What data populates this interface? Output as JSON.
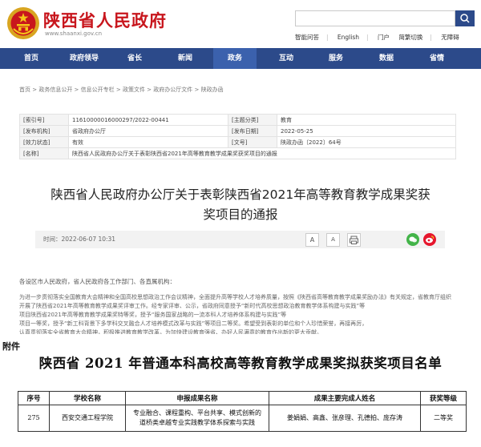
{
  "header": {
    "site_title": "陕西省人民政府",
    "site_url": "www.shaanxi.gov.cn",
    "top_links": [
      "智能问答",
      "English",
      "门户",
      "简繁切换",
      "无障碍"
    ]
  },
  "nav": {
    "items": [
      "首页",
      "政府领导",
      "省长",
      "新闻",
      "政务",
      "互动",
      "服务",
      "数据",
      "省情"
    ],
    "active": "政务"
  },
  "breadcrumb": "首页 > 政务信息公开 > 信息公开专栏 > 政策文件 > 政府办公厅文件 > 陕政办函",
  "info": {
    "labels": [
      "[索引号]",
      "[主题分类]",
      "[发布机构]",
      "[发布日期]",
      "[效力状态]",
      "[文号]",
      "[名称]"
    ],
    "index_no": "11610000016000297/2022-00441",
    "topic": "教育",
    "publisher": "省政府办公厅",
    "publish_date": "2022-05-25",
    "status": "有效",
    "doc_no": "陕政办函〔2022〕64号",
    "name": "陕西省人民政府办公厅关于表彰陕西省2021年高等教育教学成果奖获奖项目的通报"
  },
  "doc": {
    "title_line1": "陕西省人民政府办公厅关于表彰陕西省2021年高等教育教学成果奖获",
    "title_line2": "奖项目的通报"
  },
  "toolbar": {
    "date": "时间：2022-06-07 10:31",
    "font_large": "A",
    "font_small": "A",
    "print_icon": "print-icon",
    "share_icons": [
      "wechat-icon",
      "weibo-icon"
    ]
  },
  "body": {
    "greeting": "各设区市人民政府，省人民政府各工作部门、各直属机构：",
    "lines": [
      "为进一步贯彻落实全国教育大会精神和全国高校思想政治工作会议精神，全面提升高等学校人才培养质量，按照《陕西省高等教育教学成果奖励办法》有关规定，省教育厅组织",
      "开展了陕西省2021年高等教育教学成果奖评审工作。经专家评审、公示，省政府同意授予“新时代高校思想政治教育教学体系构建与实践”等",
      "项目陕西省2021年高等教育教学成果奖特等奖，授予“服务国家战略的一流本科人才培养体系构建与实践”等",
      "项目一等奖，授予“新工科背景下多学科交叉融合人才培养模式改革与实践”等项目二等奖。希望受到表彰的单位和个人珍惜荣誉，再接再厉，",
      "认真贯彻落实全省教育大会精神，积极推进教育教学改革，为加快建设教育强省、办好人民满意的教育作出新的更大贡献。"
    ]
  },
  "attachment": {
    "label": "附件",
    "title": "陕西省 2021 年普通本科高校高等教育教学成果奖拟获奖项目名单",
    "columns": [
      "序号",
      "学校名称",
      "申报成果名称",
      "成果主要完成人姓名",
      "获奖等级"
    ],
    "rows": [
      {
        "no": "275",
        "school": "西安交通工程学院",
        "title_line1": "专业融合、课程重构、平台共享、模式创新的",
        "title_line2": "道桥类卓越专业实践教学体系探索与实践",
        "people": "姜娟娟、高鑫、张彦理、孔德拍、庞存涛",
        "level": "二等奖"
      }
    ]
  },
  "colors": {
    "brand_red": "#c8161d",
    "nav_blue": "#2c4a8a",
    "nav_active": "#3b61ad"
  }
}
